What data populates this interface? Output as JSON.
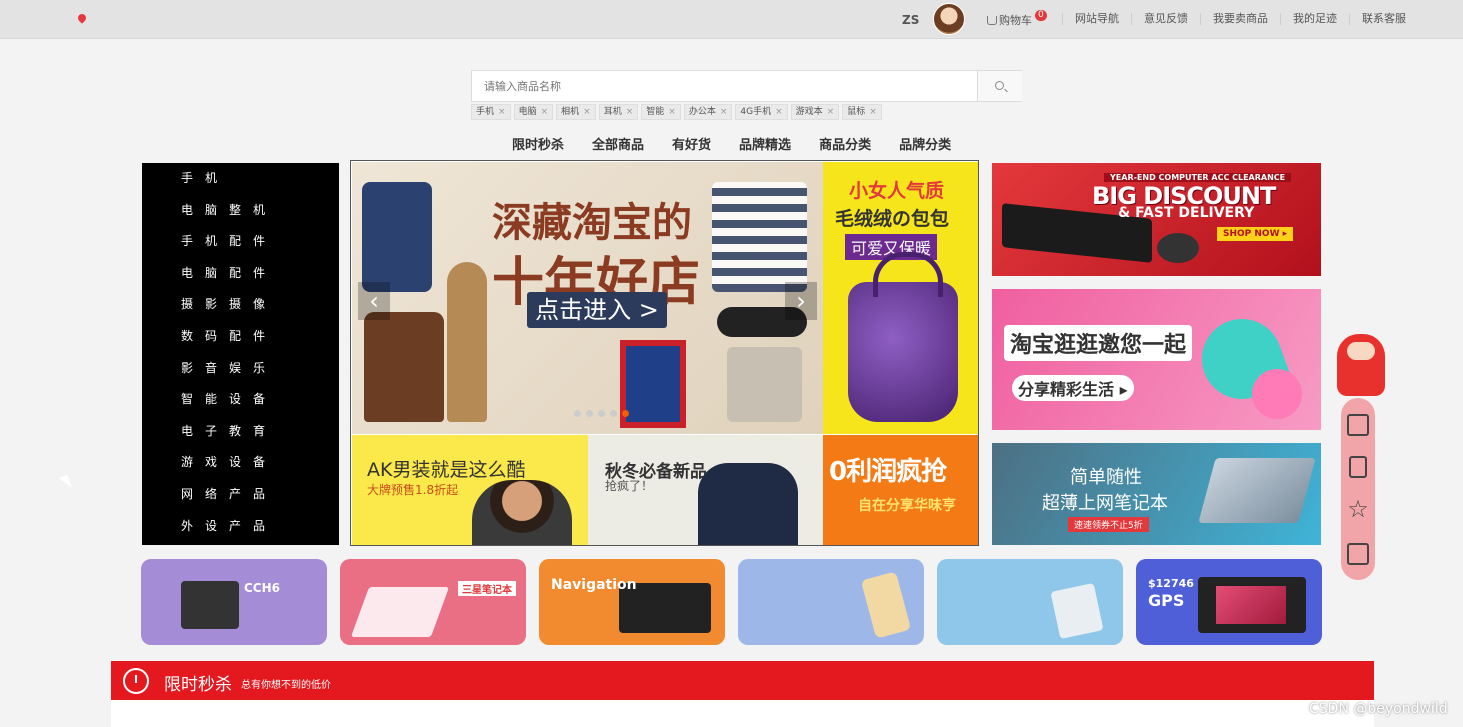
{
  "topbar": {
    "username": "ZS",
    "cart_label": "购物车",
    "cart_count": "0",
    "links": [
      "网站导航",
      "意见反馈",
      "我要卖商品",
      "我的足迹",
      "联系客服"
    ]
  },
  "search": {
    "placeholder": "请输入商品名称",
    "hot_tags": [
      "手机",
      "电脑",
      "相机",
      "耳机",
      "智能",
      "办公本",
      "4G手机",
      "游戏本",
      "鼠标"
    ]
  },
  "nav": [
    "限时秒杀",
    "全部商品",
    "有好货",
    "品牌精选",
    "商品分类",
    "品牌分类"
  ],
  "categories": [
    "手机",
    "电脑整机",
    "手机配件",
    "电脑配件",
    "摄影摄像",
    "数码配件",
    "影音娱乐",
    "智能设备",
    "电子教育",
    "游戏设备",
    "网络产品",
    "外设产品"
  ],
  "carousel": {
    "main_title_1": "深藏淘宝的",
    "main_title_2": "十年好店",
    "enter_label": "点击进入 >",
    "prev_label": "‹",
    "next_label": "›",
    "right_line1": "小女人气质",
    "right_line2": "毛绒绒の包包",
    "right_line3": "可爱又保暖",
    "b1_title": "AK男装就是这么酷",
    "b1_sub": "大牌预售1.8折起",
    "b2_title": "秋冬必备新品",
    "b2_sub": "抢疯了！",
    "b3_title": "0利润疯抢",
    "b3_sub": "自在分享华味亨"
  },
  "ads": {
    "ad1_tag": "YEAR-END COMPUTER ACC CLEARANCE",
    "ad1_big": "BIG DISCOUNT",
    "ad1_sub": "& FAST DELIVERY",
    "ad1_shop": "SHOP NOW ▸",
    "ad2_title": "淘宝逛逛邀您一起",
    "ad2_sub": "分享精彩生活 ▸",
    "ad3_line1": "简单随性",
    "ad3_line2": "超薄上网笔记本",
    "ad3_tag": "速速领券不止5折"
  },
  "cards": {
    "c1": "CCH6",
    "c2": "三星笔记本",
    "c3": "Navigation",
    "c6_price": "$12746",
    "c6_gps": "GPS"
  },
  "flash": {
    "title": "限时秒杀",
    "subtitle": "总有你想不到的低价"
  },
  "watermark": "CSDN @beyondwild"
}
